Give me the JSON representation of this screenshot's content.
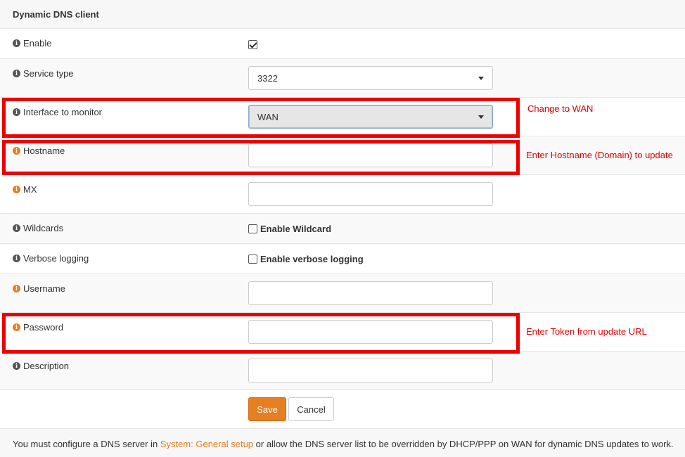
{
  "section": {
    "title": "Dynamic DNS client"
  },
  "fields": {
    "enable": {
      "label": "Enable",
      "checked": true
    },
    "service_type": {
      "label": "Service type",
      "value": "3322"
    },
    "interface": {
      "label": "Interface to monitor",
      "value": "WAN"
    },
    "hostname": {
      "label": "Hostname",
      "value": ""
    },
    "mx": {
      "label": "MX",
      "value": ""
    },
    "wildcards": {
      "label": "Wildcards",
      "checkbox_label": "Enable Wildcard",
      "checked": false
    },
    "verbose": {
      "label": "Verbose logging",
      "checkbox_label": "Enable verbose logging",
      "checked": false
    },
    "username": {
      "label": "Username",
      "value": ""
    },
    "password": {
      "label": "Password",
      "value": ""
    },
    "description": {
      "label": "Description",
      "value": ""
    }
  },
  "buttons": {
    "save": "Save",
    "cancel": "Cancel"
  },
  "annotations": {
    "interface": "Change to WAN",
    "hostname": "Enter Hostname (Domain) to update",
    "password": "Enter Token from update URL"
  },
  "footer": {
    "text_before": "You must configure a DNS server in ",
    "link": "System: General setup",
    "text_after": " or allow the DNS server list to be overridden by DHCP/PPP on WAN for dynamic DNS updates to work."
  },
  "colors": {
    "accent": "#e67e22",
    "highlight": "#ee0000",
    "annotation_text": "#e00000"
  },
  "icons": {
    "info_neutral": "info-circle-icon",
    "info_required": "info-circle-icon-orange",
    "caret": "caret-down-icon",
    "check": "checkmark-icon"
  }
}
